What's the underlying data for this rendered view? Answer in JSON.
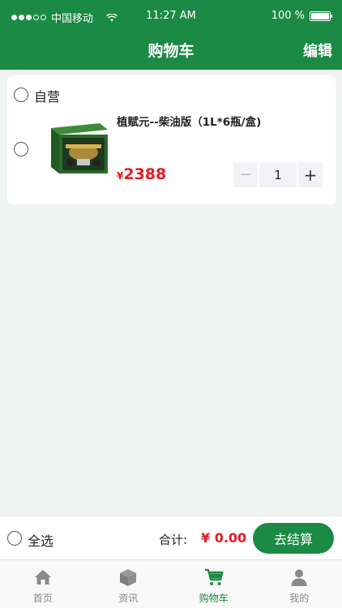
{
  "status_bar": {
    "carrier": "中国移动",
    "time": "11:27 AM",
    "battery": "100 %"
  },
  "nav": {
    "title": "购物车",
    "edit_label": "编辑"
  },
  "cart": {
    "shop_name": "自营",
    "items": [
      {
        "title": "植赋元--柴油版（1L*6瓶/盒)",
        "currency": "¥",
        "price": "2388",
        "quantity": "1",
        "minus_label": "−",
        "plus_label": "+"
      }
    ]
  },
  "footer": {
    "select_all_label": "全选",
    "total_label": "合计:",
    "total_value": "¥ 0.00",
    "checkout_label": "去结算"
  },
  "tabs": [
    {
      "label": "首页",
      "icon": "home-icon",
      "active": false
    },
    {
      "label": "资讯",
      "icon": "box-icon",
      "active": false
    },
    {
      "label": "购物车",
      "icon": "cart-icon",
      "active": true
    },
    {
      "label": "我的",
      "icon": "user-icon",
      "active": false
    }
  ],
  "colors": {
    "brand_green": "#1a8a44",
    "price_red": "#e21c24",
    "background": "#eff3f1"
  }
}
